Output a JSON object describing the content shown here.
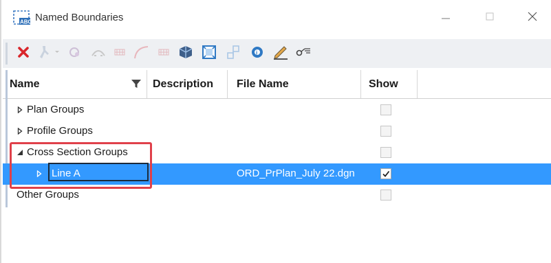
{
  "window": {
    "title": "Named Boundaries",
    "app_icon": "named-boundaries-abc-icon",
    "controls": [
      "minimize-icon",
      "maximize-icon",
      "close-icon"
    ]
  },
  "toolbar": {
    "items": [
      {
        "name": "delete-icon",
        "enabled": true,
        "color": "#d9262b"
      },
      {
        "name": "create-boundary-icon",
        "enabled": false
      },
      {
        "name": "dropdown-chevron-icon",
        "enabled": false
      },
      {
        "name": "civil-plan-boundary-icon",
        "enabled": false
      },
      {
        "name": "profile-boundary-icon",
        "enabled": false
      },
      {
        "name": "grid-boundary-icon",
        "enabled": false
      },
      {
        "name": "curve-boundary-icon",
        "enabled": false
      },
      {
        "name": "grid-boundary-2-icon",
        "enabled": false
      },
      {
        "name": "3d-model-icon",
        "enabled": true
      },
      {
        "name": "fit-view-icon",
        "enabled": true
      },
      {
        "name": "group-icon",
        "enabled": false
      },
      {
        "name": "properties-icon",
        "enabled": true
      },
      {
        "name": "pencil-edit-icon",
        "enabled": true
      },
      {
        "name": "key-filter-icon",
        "enabled": true
      }
    ]
  },
  "columns": {
    "name": "Name",
    "description": "Description",
    "file_name": "File Name",
    "show": "Show",
    "filter_icon": "filter-funnel-icon"
  },
  "rows": [
    {
      "label": "Plan Groups",
      "expander": "collapsed",
      "level": 0,
      "show": false
    },
    {
      "label": "Profile Groups",
      "expander": "collapsed",
      "level": 0,
      "show": false
    },
    {
      "label": "Cross Section Groups",
      "expander": "expanded",
      "level": 0,
      "show": false
    },
    {
      "label": "Line A",
      "expander": "collapsed",
      "level": 1,
      "file_name": "ORD_PrPlan_July 22.dgn",
      "show": true,
      "selected": true
    },
    {
      "label": "Other Groups",
      "expander": "none",
      "level": 0,
      "show": false
    }
  ],
  "colors": {
    "selection": "#3399ff",
    "highlight_annotation": "#e0404a",
    "toolbar_bg": "#eef0f3"
  }
}
